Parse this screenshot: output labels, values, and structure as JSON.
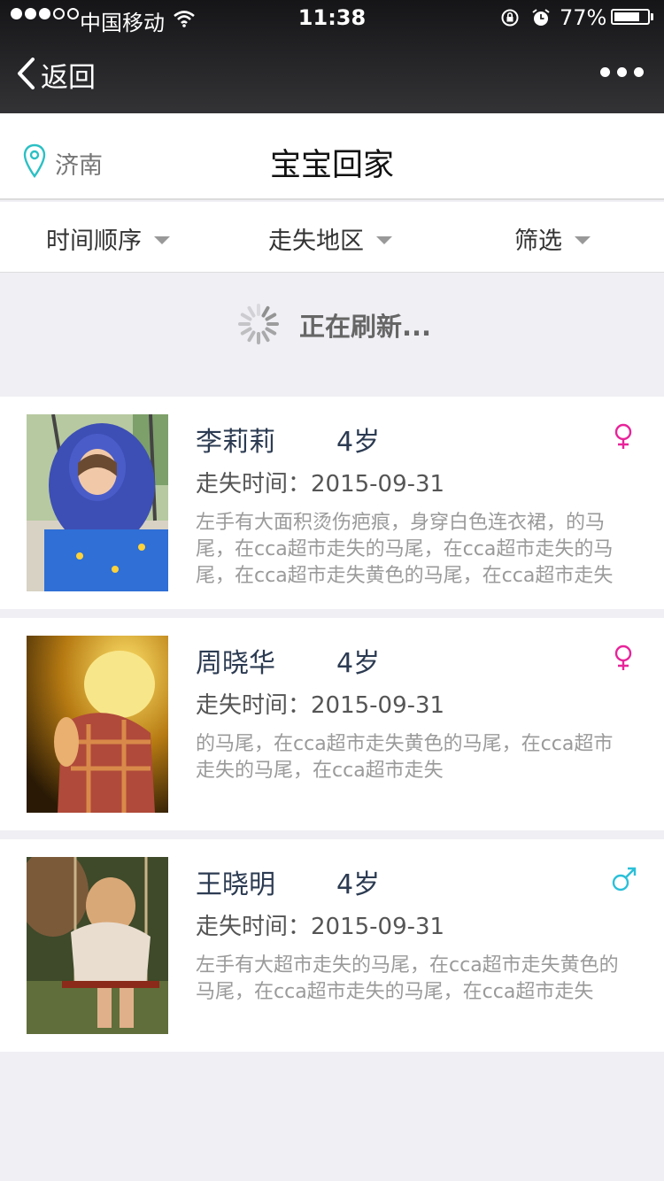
{
  "status_bar": {
    "carrier": "中国移动",
    "time": "11:38",
    "battery_percent": "77%",
    "battery_level": 0.77,
    "signal_bars": 3
  },
  "nav": {
    "back_label": "返回",
    "more_icon": "more-dots-icon"
  },
  "header": {
    "location": "济南",
    "title": "宝宝回家",
    "accent_color": "#2bc0c4"
  },
  "filters": [
    {
      "label": "时间顺序"
    },
    {
      "label": "走失地区"
    },
    {
      "label": "筛选"
    }
  ],
  "refresh": {
    "label": "正在刷新..."
  },
  "children": [
    {
      "name": "李莉莉",
      "age": "4岁",
      "gender": "female",
      "gender_symbol": "♀",
      "lost_time": "走失时间：2015-09-31",
      "description": "左手有大面积烫伤疤痕，身穿白色连衣裙，的马尾，在cca超市走失的马尾，在cca超市走失的马尾，在cca超市走失黄色的马尾，在cca超市走失"
    },
    {
      "name": "周晓华",
      "age": "4岁",
      "gender": "female",
      "gender_symbol": "♀",
      "lost_time": "走失时间：2015-09-31",
      "description": "的马尾，在cca超市走失黄色的马尾，在cca超市走失的马尾，在cca超市走失"
    },
    {
      "name": "王晓明",
      "age": "4岁",
      "gender": "male",
      "gender_symbol": "♂",
      "lost_time": "走失时间：2015-09-31",
      "description": "左手有大超市走失的马尾，在cca超市走失黄色的马尾，在cca超市走失的马尾，在cca超市走失"
    }
  ],
  "colors": {
    "female": "#e8249a",
    "male": "#2bc0d8",
    "name_text": "#2c3b52"
  }
}
